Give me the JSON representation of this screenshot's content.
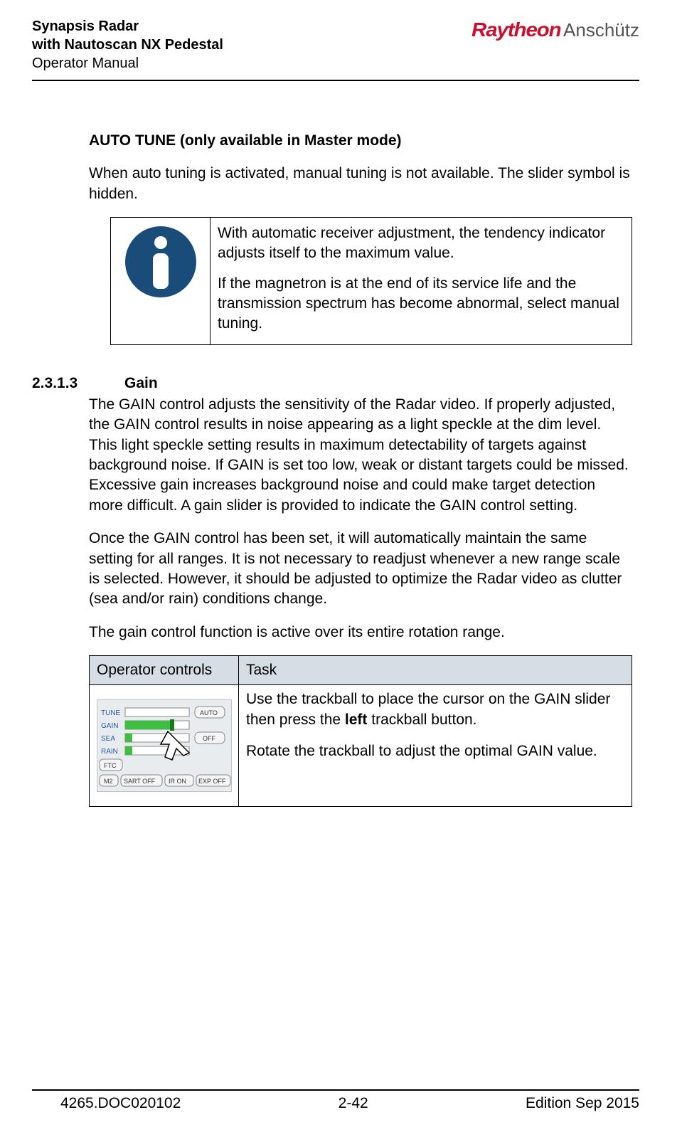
{
  "header": {
    "title_line1": "Synapsis Radar",
    "title_line2": "with Nautoscan NX Pedestal",
    "title_line3": "Operator Manual",
    "brand1": "Raytheon",
    "brand2": "Anschütz"
  },
  "auto_tune": {
    "heading": "AUTO TUNE (only available in Master mode)",
    "para": "When auto tuning is activated, manual tuning is not available. The slider symbol is hidden.",
    "note_p1": "With automatic receiver adjustment, the tendency indicator adjusts itself to the maximum value.",
    "note_p2": "If the magnetron is at the end of its service life and the transmission spectrum has become abnormal, select manual tuning."
  },
  "gain": {
    "section_number": "2.3.1.3",
    "section_title": "Gain",
    "p1": "The GAIN control adjusts the sensitivity of the Radar video. If properly adjusted, the GAIN control results in noise appearing as a light speckle at the dim level. This light speckle setting results in maximum detectability of targets against background noise. If GAIN is set too low, weak or distant targets could be missed. Excessive gain increases background noise and could make target detection more difficult. A gain slider is provided to indicate the GAIN control setting.",
    "p2": "Once the GAIN control has been set, it will automatically maintain the same setting for all ranges. It is not necessary to readjust whenever a new range scale is selected. However, it should be adjusted to optimize the Radar video as clutter (sea and/or rain) conditions change.",
    "p3": "The gain control function is active over its entire rotation range."
  },
  "table": {
    "header_col1": "Operator controls",
    "header_col2": "Task",
    "task_p1_a": "Use the trackball to place the cursor on the GAIN slider then press the ",
    "task_p1_bold": "left",
    "task_p1_b": " trackball button.",
    "task_p2": "Rotate the trackball to adjust the optimal GAIN value."
  },
  "panel": {
    "rows": [
      "TUNE",
      "GAIN",
      "SEA",
      "RAIN"
    ],
    "btn_auto": "AUTO",
    "btn_off": "OFF",
    "btn_ftc": "FTC",
    "btn_m2": "M2",
    "btn_sart": "SART OFF",
    "btn_ir": "IR ON",
    "btn_exp": "EXP OFF"
  },
  "footer": {
    "doc": "4265.DOC020102",
    "page": "2-42",
    "edition": "Edition Sep 2015"
  }
}
